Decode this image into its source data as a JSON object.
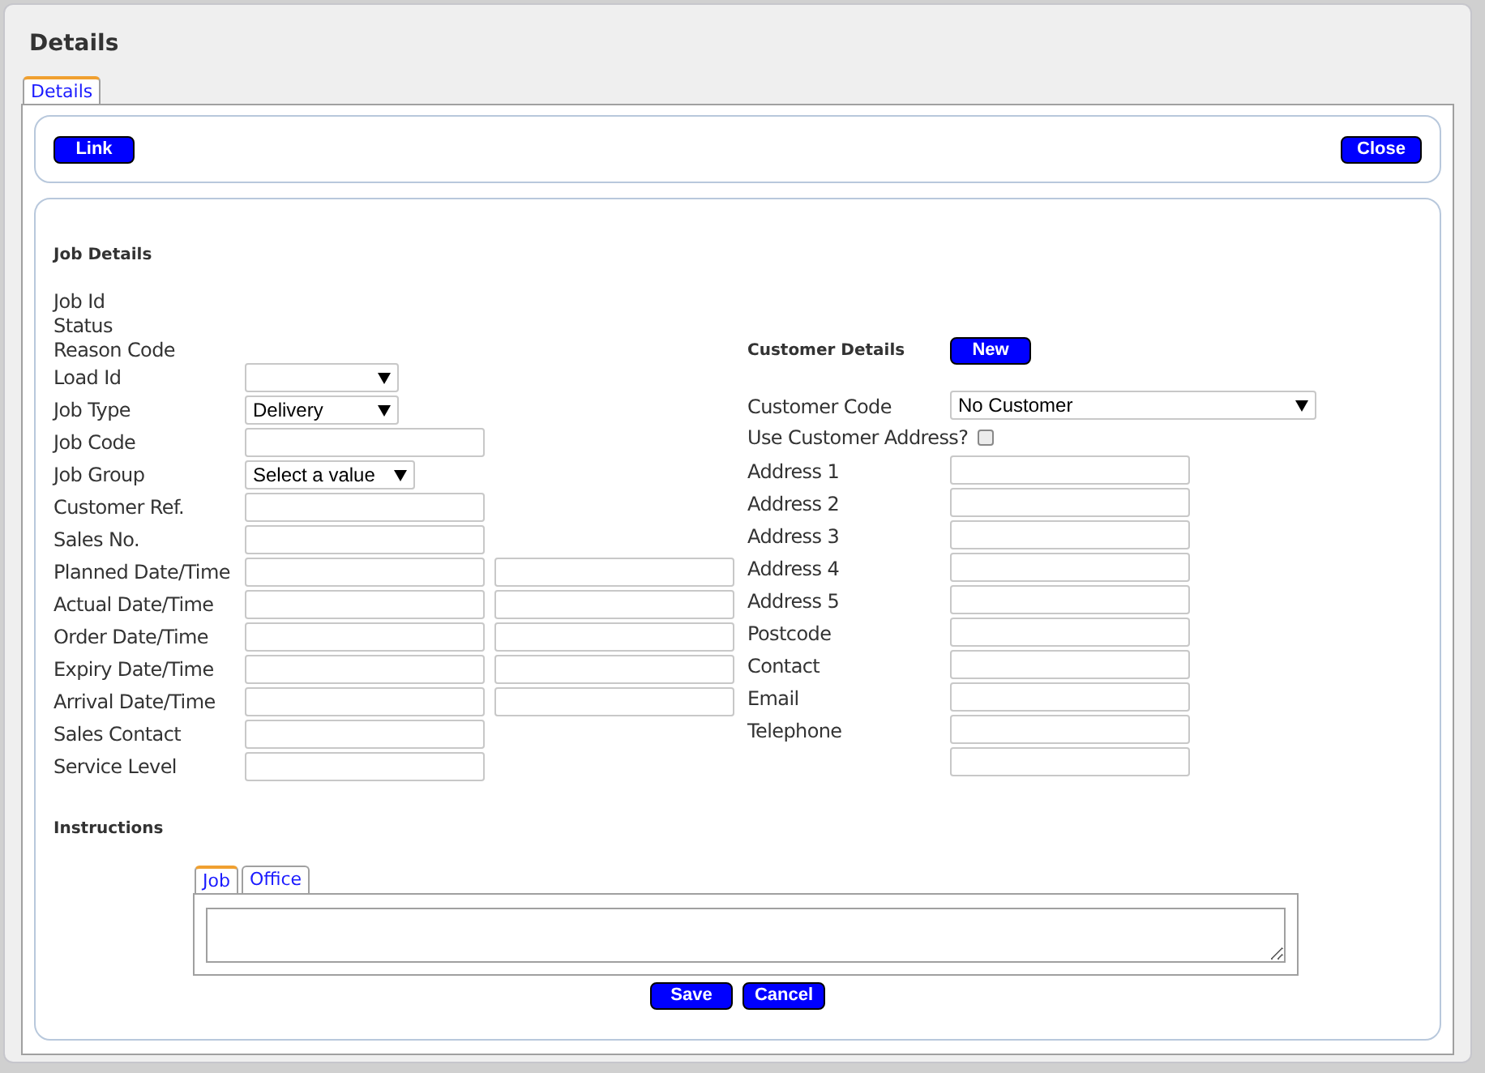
{
  "window": {
    "title": "Details"
  },
  "tabs": [
    {
      "label": "Details",
      "selected": true
    }
  ],
  "toolbar": {
    "buttons": [
      {
        "label": "Link"
      },
      {
        "label": "Close"
      }
    ]
  },
  "job_details": {
    "heading": "Job Details",
    "fields": [
      {
        "label": "Job Id",
        "kind": "label"
      },
      {
        "label": "Status",
        "kind": "label"
      },
      {
        "label": "Reason Code",
        "kind": "label"
      },
      {
        "label": "Load Id",
        "kind": "select"
      },
      {
        "label": "Job Type",
        "kind": "select",
        "value": "Delivery"
      },
      {
        "label": "Job Code",
        "kind": "input"
      },
      {
        "label": "Job Group",
        "kind": "select",
        "value": "Select a value"
      },
      {
        "label": "Customer Ref.",
        "kind": "input"
      },
      {
        "label": "Sales No.",
        "kind": "input"
      },
      {
        "label": "Planned Date/Time",
        "kind": "datetime"
      },
      {
        "label": "Actual Date/Time",
        "kind": "datetime"
      },
      {
        "label": "Order Date/Time",
        "kind": "datetime"
      },
      {
        "label": "Expiry Date/Time",
        "kind": "datetime"
      },
      {
        "label": "Arrival Date/Time",
        "kind": "datetime"
      },
      {
        "label": "Sales Contact",
        "kind": "input"
      },
      {
        "label": "Service Level",
        "kind": "input"
      }
    ]
  },
  "customer_details": {
    "heading": "Customer Details",
    "new_button": "New",
    "fields": [
      {
        "label": "Customer Code",
        "kind": "select",
        "value": "No Customer"
      },
      {
        "label": "Use Customer Address?",
        "kind": "checkbox",
        "checked": false
      },
      {
        "label": "Address 1",
        "kind": "input"
      },
      {
        "label": "Address 2",
        "kind": "input"
      },
      {
        "label": "Address 3",
        "kind": "input"
      },
      {
        "label": "Address 4",
        "kind": "input"
      },
      {
        "label": "Address 5",
        "kind": "input"
      },
      {
        "label": "Postcode",
        "kind": "input"
      },
      {
        "label": "Contact",
        "kind": "input"
      },
      {
        "label": "Email",
        "kind": "input"
      },
      {
        "label": "Telephone",
        "kind": "input"
      },
      {
        "kind": "input"
      }
    ]
  },
  "instructions": {
    "heading": "Instructions",
    "tabs": [
      {
        "label": "Job",
        "selected": true
      },
      {
        "label": "Office",
        "selected": false
      }
    ]
  },
  "footer_buttons": [
    {
      "label": "Save"
    },
    {
      "label": "Cancel"
    }
  ]
}
